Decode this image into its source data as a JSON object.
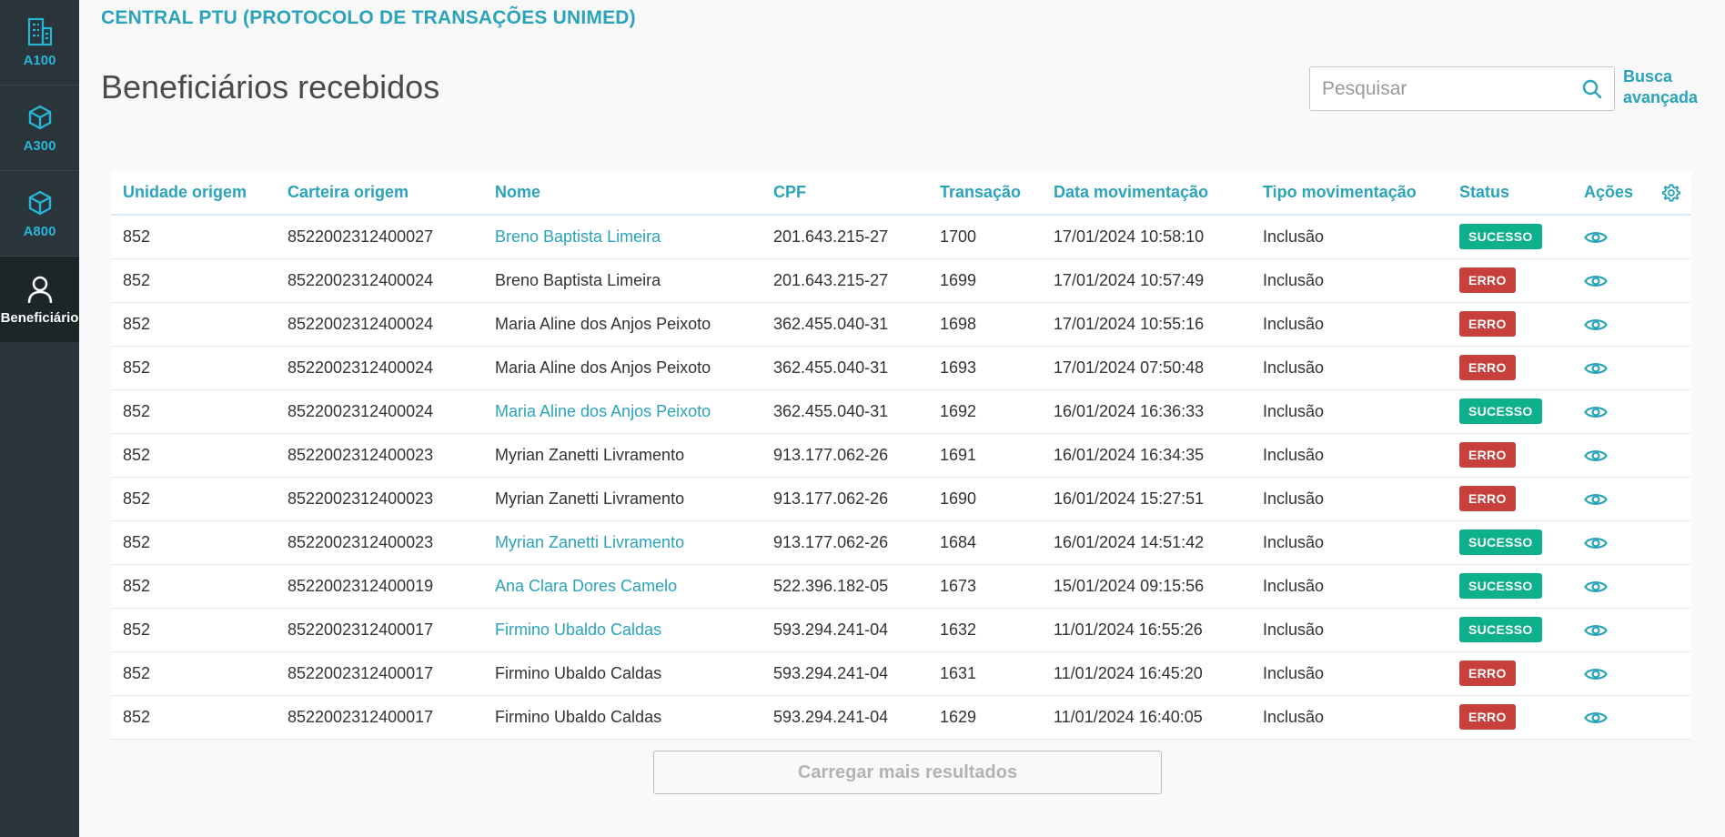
{
  "sidebar": {
    "items": [
      {
        "label": "A100",
        "icon": "building-icon",
        "active": false
      },
      {
        "label": "A300",
        "icon": "cube-icon",
        "active": false
      },
      {
        "label": "A800",
        "icon": "cube-icon",
        "active": false
      },
      {
        "label": "Beneficiário",
        "icon": "user-icon",
        "active": true
      }
    ]
  },
  "header": {
    "breadcrumb": "CENTRAL PTU (PROTOCOLO DE TRANSAÇÕES UNIMED)",
    "title": "Beneficiários recebidos"
  },
  "search": {
    "placeholder": "Pesquisar",
    "value": "",
    "advanced_label": "Busca avançada"
  },
  "table": {
    "columns": [
      "Unidade origem",
      "Carteira origem",
      "Nome",
      "CPF",
      "Transação",
      "Data movimentação",
      "Tipo movimentação",
      "Status",
      "Ações"
    ],
    "rows": [
      {
        "unidade": "852",
        "carteira": "8522002312400027",
        "nome": "Breno Baptista Limeira",
        "cpf": "201.643.215-27",
        "transacao": "1700",
        "data": "17/01/2024 10:58:10",
        "tipo": "Inclusão",
        "status": "SUCESSO"
      },
      {
        "unidade": "852",
        "carteira": "8522002312400024",
        "nome": "Breno Baptista Limeira",
        "cpf": "201.643.215-27",
        "transacao": "1699",
        "data": "17/01/2024 10:57:49",
        "tipo": "Inclusão",
        "status": "ERRO"
      },
      {
        "unidade": "852",
        "carteira": "8522002312400024",
        "nome": "Maria Aline dos Anjos Peixoto",
        "cpf": "362.455.040-31",
        "transacao": "1698",
        "data": "17/01/2024 10:55:16",
        "tipo": "Inclusão",
        "status": "ERRO"
      },
      {
        "unidade": "852",
        "carteira": "8522002312400024",
        "nome": "Maria Aline dos Anjos Peixoto",
        "cpf": "362.455.040-31",
        "transacao": "1693",
        "data": "17/01/2024 07:50:48",
        "tipo": "Inclusão",
        "status": "ERRO"
      },
      {
        "unidade": "852",
        "carteira": "8522002312400024",
        "nome": "Maria Aline dos Anjos Peixoto",
        "cpf": "362.455.040-31",
        "transacao": "1692",
        "data": "16/01/2024 16:36:33",
        "tipo": "Inclusão",
        "status": "SUCESSO"
      },
      {
        "unidade": "852",
        "carteira": "8522002312400023",
        "nome": "Myrian Zanetti Livramento",
        "cpf": "913.177.062-26",
        "transacao": "1691",
        "data": "16/01/2024 16:34:35",
        "tipo": "Inclusão",
        "status": "ERRO"
      },
      {
        "unidade": "852",
        "carteira": "8522002312400023",
        "nome": "Myrian Zanetti Livramento",
        "cpf": "913.177.062-26",
        "transacao": "1690",
        "data": "16/01/2024 15:27:51",
        "tipo": "Inclusão",
        "status": "ERRO"
      },
      {
        "unidade": "852",
        "carteira": "8522002312400023",
        "nome": "Myrian Zanetti Livramento",
        "cpf": "913.177.062-26",
        "transacao": "1684",
        "data": "16/01/2024 14:51:42",
        "tipo": "Inclusão",
        "status": "SUCESSO"
      },
      {
        "unidade": "852",
        "carteira": "8522002312400019",
        "nome": "Ana Clara Dores Camelo",
        "cpf": "522.396.182-05",
        "transacao": "1673",
        "data": "15/01/2024 09:15:56",
        "tipo": "Inclusão",
        "status": "SUCESSO"
      },
      {
        "unidade": "852",
        "carteira": "8522002312400017",
        "nome": "Firmino Ubaldo Caldas",
        "cpf": "593.294.241-04",
        "transacao": "1632",
        "data": "11/01/2024 16:55:26",
        "tipo": "Inclusão",
        "status": "SUCESSO"
      },
      {
        "unidade": "852",
        "carteira": "8522002312400017",
        "nome": "Firmino Ubaldo Caldas",
        "cpf": "593.294.241-04",
        "transacao": "1631",
        "data": "11/01/2024 16:45:20",
        "tipo": "Inclusão",
        "status": "ERRO"
      },
      {
        "unidade": "852",
        "carteira": "8522002312400017",
        "nome": "Firmino Ubaldo Caldas",
        "cpf": "593.294.241-04",
        "transacao": "1629",
        "data": "11/01/2024 16:40:05",
        "tipo": "Inclusão",
        "status": "ERRO"
      }
    ]
  },
  "load_more_label": "Carregar mais resultados",
  "colors": {
    "accent": "#2aa3bb",
    "sidebar_bg": "#29353a",
    "success": "#0db08b",
    "error": "#c8403c"
  }
}
